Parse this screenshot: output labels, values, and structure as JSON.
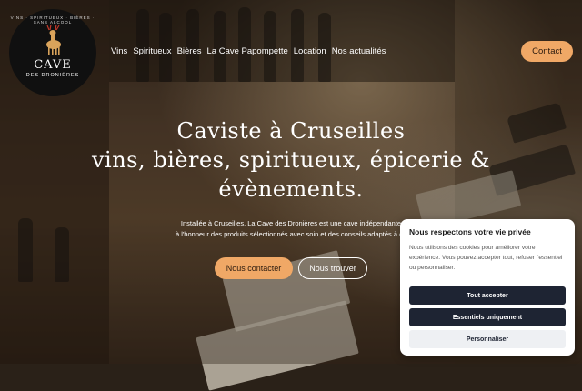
{
  "logo": {
    "arc_text": "VINS · SPIRITUEUX · BIÈRES · SANS ALCOOL",
    "name": "CAVE",
    "subname": "DES DRONIÈRES",
    "icon": "deer-icon"
  },
  "nav": {
    "items": [
      "Vins",
      "Spiritueux",
      "Bières",
      "La Cave Papompette",
      "Location",
      "Nos actualités"
    ],
    "contact": "Contact"
  },
  "hero": {
    "title_line1": "Caviste à Cruseilles",
    "title_line2": "vins, bières, spiritueux, épicerie &",
    "title_line3": "évènements.",
    "text_line1": "Installée à Cruseilles, La Cave des Dronières est une cave indépendante",
    "text_line2": "à l'honneur des produits sélectionnés avec soin et des conseils adaptés à ch",
    "primary_button": "Nous contacter",
    "secondary_button": "Nous trouver"
  },
  "cookie": {
    "title": "Nous respectons votre vie privée",
    "text": "Nous utilisons des cookies pour améliorer votre expérience. Vous pouvez accepter tout, refuser l'essentiel ou personnaliser.",
    "accept": "Tout accepter",
    "essential": "Essentiels uniquement",
    "customize": "Personnaliser"
  },
  "colors": {
    "accent": "#f0a866",
    "dark_button": "#1e2433",
    "logo_bg": "#101010"
  }
}
